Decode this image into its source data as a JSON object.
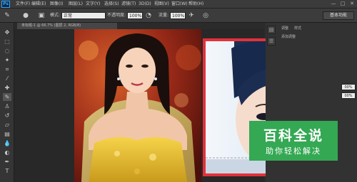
{
  "app": {
    "logo": "Ps"
  },
  "menu": [
    "文件(F)",
    "编辑(E)",
    "图像(I)",
    "图层(L)",
    "文字(Y)",
    "选择(S)",
    "滤镜(T)",
    "3D(D)",
    "视图(V)",
    "窗口(W)",
    "帮助(H)"
  ],
  "window_controls": [
    "—",
    "□",
    "✕"
  ],
  "options": {
    "mode_label": "模式:",
    "mode_value": "正常",
    "opacity_label": "不透明度:",
    "opacity_value": "100%",
    "flow_label": "流量:",
    "flow_value": "100%",
    "workspace": "基本功能"
  },
  "document": {
    "tab_title": "未标题-1 @ 66.7% (图层 2, RGB/8)"
  },
  "panels": {
    "tab_adjust": "调整",
    "tab_style": "样式",
    "add_adjust": "添加调整",
    "opacity_1": "00%",
    "opacity_2": "00%"
  },
  "watermark": {
    "title": "百科全说",
    "subtitle": "助你轻松解决"
  },
  "colors": {
    "accent": "#e3313a",
    "watermark_bg": "#34a853",
    "ps_blue": "#31a8ff"
  }
}
